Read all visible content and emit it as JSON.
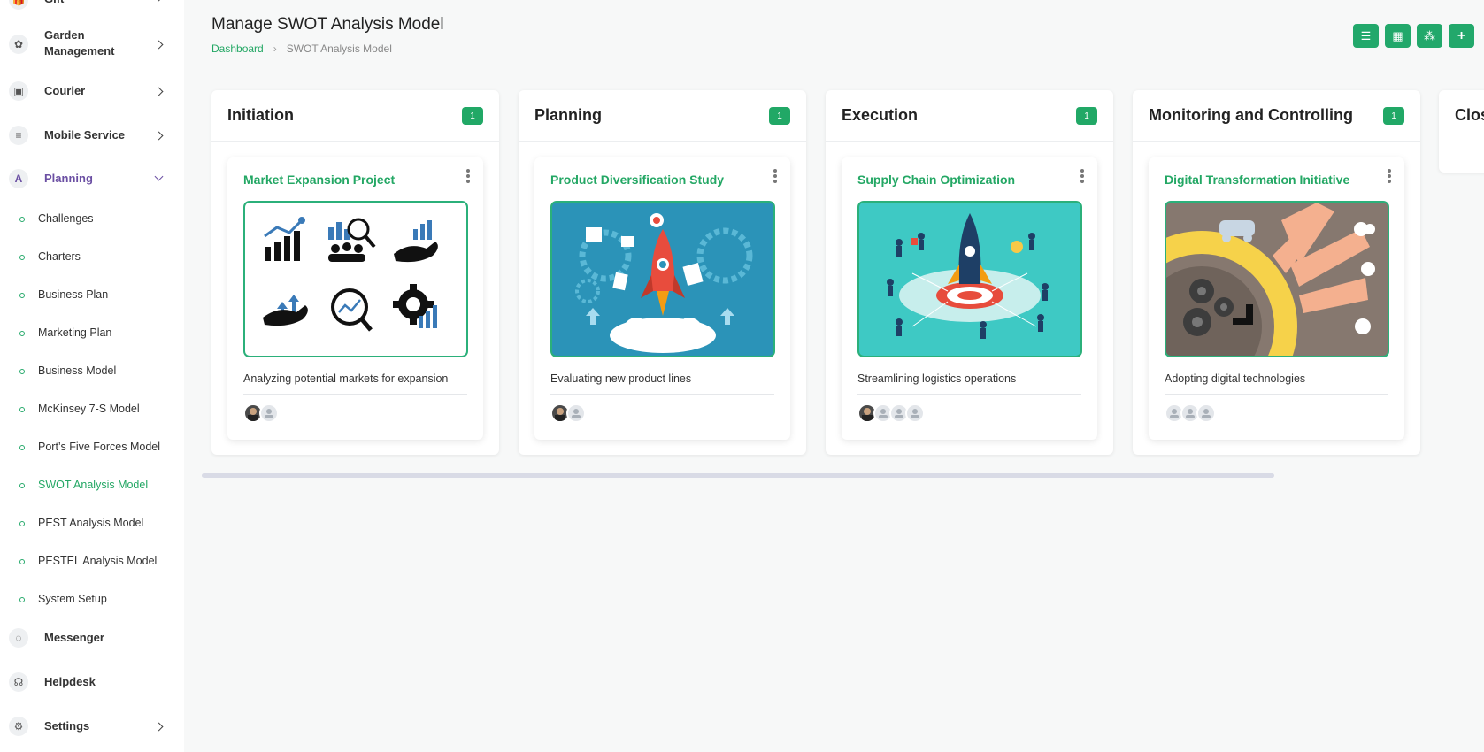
{
  "sidebar": {
    "items": [
      {
        "label": "Gift",
        "icon": "gift-icon"
      },
      {
        "label": "Garden Management",
        "icon": "tree-icon"
      },
      {
        "label": "Courier",
        "icon": "box-icon"
      },
      {
        "label": "Mobile Service",
        "icon": "menu-icon"
      },
      {
        "label": "Planning",
        "icon": "planning-icon"
      }
    ],
    "submenu": [
      "Challenges",
      "Charters",
      "Business Plan",
      "Marketing Plan",
      "Business Model",
      "McKinsey 7-S Model",
      "Port’s Five Forces Model",
      "SWOT Analysis Model",
      "PEST Analysis Model",
      "PESTEL Analysis Model",
      "System Setup"
    ],
    "bottom": [
      {
        "label": "Messenger",
        "icon": "chat-icon"
      },
      {
        "label": "Helpdesk",
        "icon": "headset-icon"
      },
      {
        "label": "Settings",
        "icon": "gear-icon"
      }
    ]
  },
  "page": {
    "title": "Manage SWOT Analysis Model",
    "breadcrumb": {
      "home": "Dashboard",
      "current": "SWOT Analysis Model"
    }
  },
  "toolbar": {
    "buttons": [
      "list-view-icon",
      "grid-view-icon",
      "kanban-icon",
      "plus-icon"
    ]
  },
  "columns": [
    {
      "title": "Initiation",
      "count": "1",
      "card": {
        "title": "Market Expansion Project",
        "desc": "Analyzing potential markets for expansion"
      }
    },
    {
      "title": "Planning",
      "count": "1",
      "card": {
        "title": "Product Diversification Study",
        "desc": "Evaluating new product lines"
      }
    },
    {
      "title": "Execution",
      "count": "1",
      "card": {
        "title": "Supply Chain Optimization",
        "desc": "Streamlining logistics operations"
      }
    },
    {
      "title": "Monitoring and Controlling",
      "count": "1",
      "card": {
        "title": "Digital Transformation Initiative",
        "desc": "Adopting digital technologies"
      }
    },
    {
      "title": "Clos"
    }
  ],
  "colors": {
    "accent": "#22a86b",
    "active_menu": "#6b4fa3"
  }
}
